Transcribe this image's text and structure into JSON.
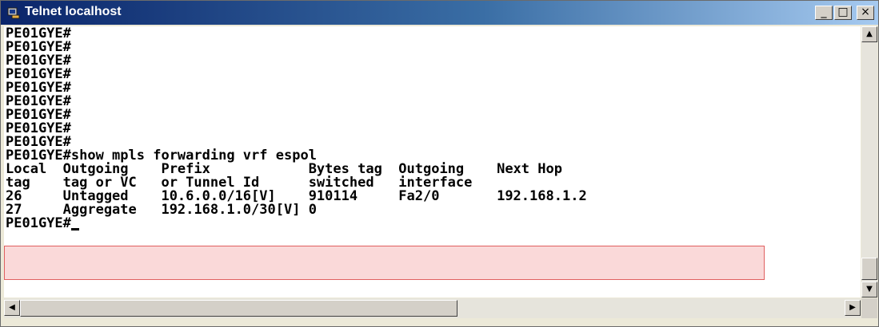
{
  "window": {
    "title": "Telnet localhost"
  },
  "title_buttons": {
    "minimize": "_",
    "maximize": "□",
    "close": "×"
  },
  "terminal": {
    "lines": [
      "PE01GYE#",
      "PE01GYE#",
      "PE01GYE#",
      "PE01GYE#",
      "PE01GYE#",
      "PE01GYE#",
      "PE01GYE#",
      "PE01GYE#",
      "PE01GYE#",
      "PE01GYE#show mpls forwarding vrf espol",
      "Local  Outgoing    Prefix            Bytes tag  Outgoing    Next Hop",
      "tag    tag or VC   or Tunnel Id      switched   interface",
      "26     Untagged    10.6.0.0/16[V]    910114     Fa2/0       192.168.1.2",
      "27     Aggregate   192.168.1.0/30[V] 0"
    ],
    "prompt": "PE01GYE#"
  },
  "colors": {
    "highlight_border": "#e06060",
    "highlight_fill": "#f7c8c8"
  }
}
